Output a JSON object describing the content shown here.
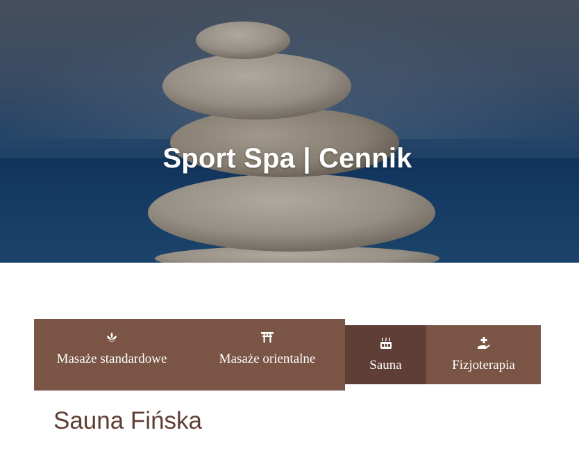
{
  "hero": {
    "title": "Sport Spa | Cennik"
  },
  "tabs": [
    {
      "label": "Masaże standardowe",
      "icon": "lotus-icon",
      "active": false
    },
    {
      "label": "Masaże orientalne",
      "icon": "torii-gate-icon",
      "active": false
    },
    {
      "label": "Sauna",
      "icon": "sauna-icon",
      "active": true
    },
    {
      "label": "Fizjoterapia",
      "icon": "hand-medical-icon",
      "active": false
    }
  ],
  "section": {
    "title": "Sauna Fińska"
  },
  "colors": {
    "tab_background": "#7a5546",
    "tab_active_background": "#5f3f35",
    "tab_text": "#ffffff",
    "section_title": "#5f3f35"
  }
}
